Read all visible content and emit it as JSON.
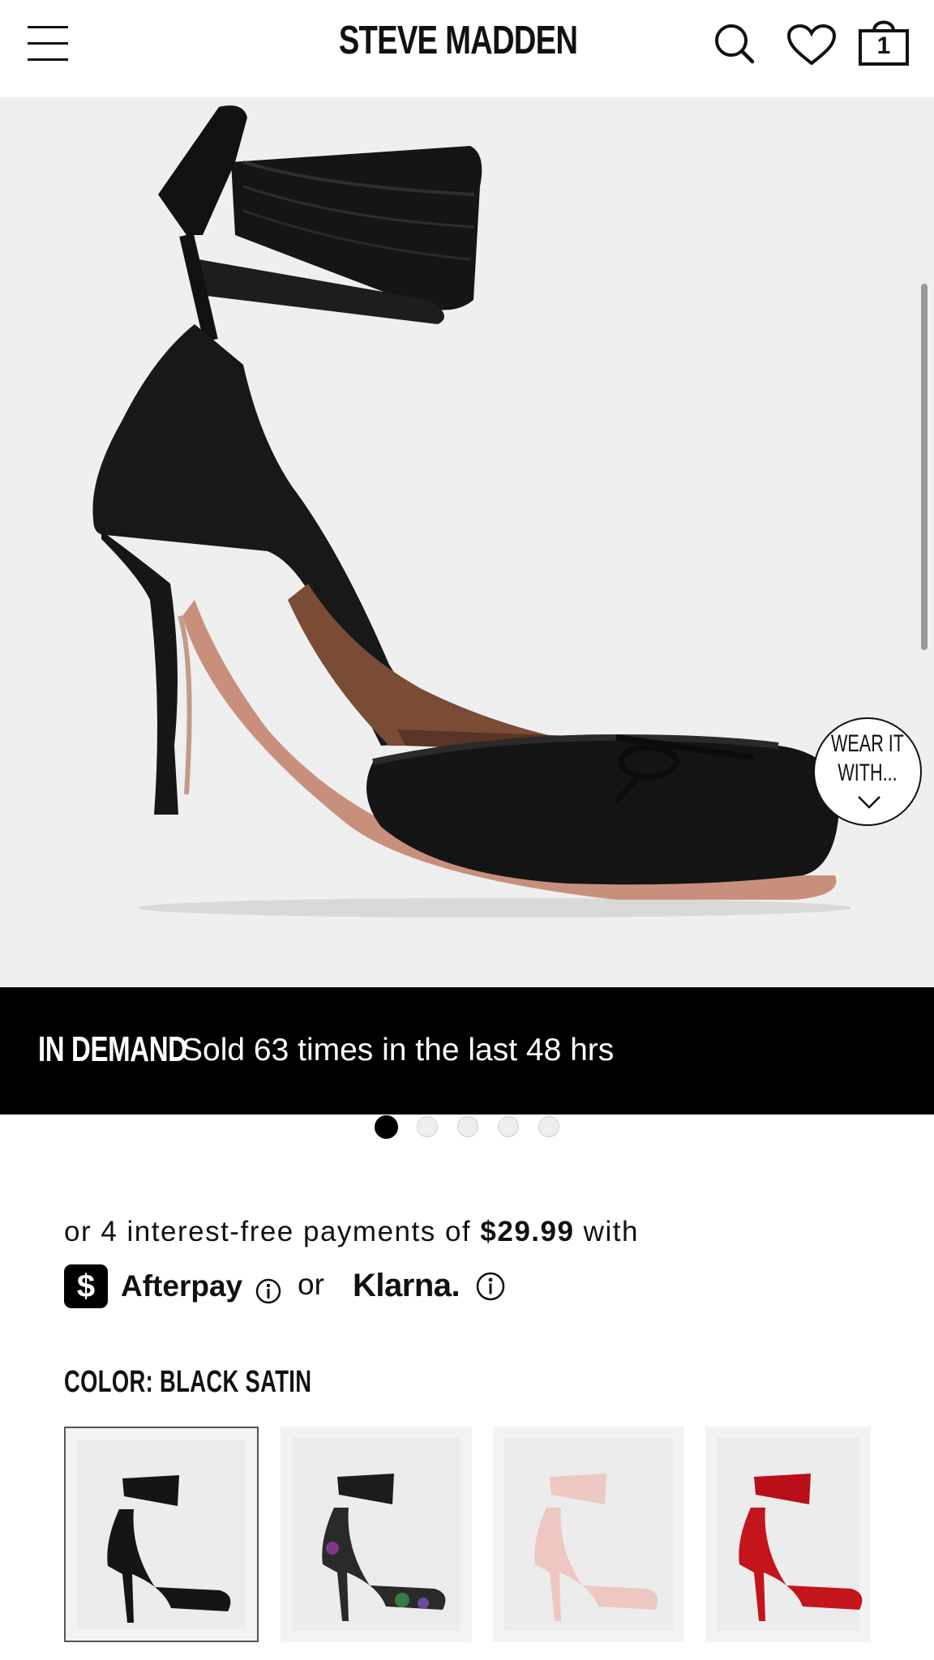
{
  "header": {
    "brand": "STEVE MADDEN",
    "icons": [
      "menu-icon",
      "search-icon",
      "heart-icon",
      "cart-icon"
    ],
    "cart_count": "1"
  },
  "hero": {
    "wear_it_line1": "WEAR IT",
    "wear_it_line2": "WITH...",
    "slide_count": 5,
    "active_slide": 1
  },
  "demand_banner": {
    "label": "IN DEMAND",
    "text": "Sold 63 times in the last 48 hrs"
  },
  "payments": {
    "line_prefix": "or 4 interest-free payments of ",
    "amount": "$29.99",
    "line_suffix": " with",
    "afterpay_symbol": "$",
    "afterpay": "Afterpay",
    "or": "or",
    "klarna": "Klarna."
  },
  "color": {
    "label": "COLOR: BLACK SATIN",
    "swatches": [
      {
        "name": "Black Satin",
        "upper": "#151515",
        "selected": true
      },
      {
        "name": "Floral",
        "upper": "#2a2a2a",
        "selected": false
      },
      {
        "name": "Blush",
        "upper": "#efc7c2",
        "selected": false
      },
      {
        "name": "Red",
        "upper": "#c4141c",
        "selected": false
      }
    ]
  },
  "colors": {
    "banner_bg": "#000000",
    "hero_bg": "#efefef",
    "text": "#111111"
  }
}
